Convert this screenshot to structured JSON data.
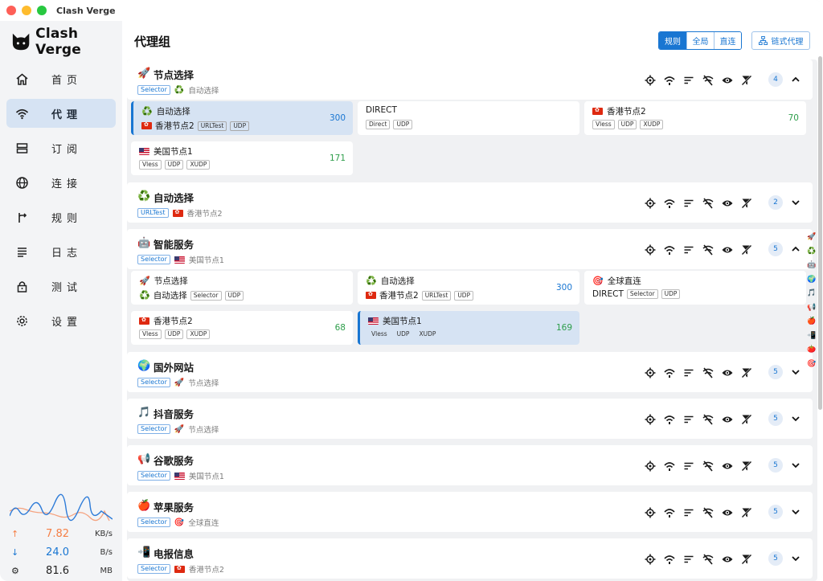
{
  "window": {
    "title": "Clash Verge"
  },
  "brand": {
    "name": "Clash Verge"
  },
  "nav": [
    {
      "label": "首页",
      "icon": "home-icon"
    },
    {
      "label": "代理",
      "icon": "wifi-icon",
      "active": true
    },
    {
      "label": "订阅",
      "icon": "storage-icon"
    },
    {
      "label": "连接",
      "icon": "globe-icon"
    },
    {
      "label": "规则",
      "icon": "fork-icon"
    },
    {
      "label": "日志",
      "icon": "lines-icon"
    },
    {
      "label": "测试",
      "icon": "lock-icon"
    },
    {
      "label": "设置",
      "icon": "gear-icon"
    }
  ],
  "stats": {
    "upload": {
      "value": "7.82",
      "unit": "KB/s",
      "color": "#f57f45"
    },
    "download": {
      "value": "24.0",
      "unit": "B/s",
      "color": "#1976d2"
    },
    "memory": {
      "value": "81.6",
      "unit": "MB"
    }
  },
  "header": {
    "title": "代理组",
    "modes": [
      "规则",
      "全局",
      "直连"
    ],
    "active_mode": "规则",
    "chain_label": "链式代理"
  },
  "colors": {
    "accent": "#1976d2",
    "delay_green": "#2e9e4b",
    "selected_bg": "#d6e3f3"
  },
  "groups": [
    {
      "icon": "🚀",
      "name": "节点选择",
      "type": "Selector",
      "now_icon": "♻️",
      "now": "自动选择",
      "count": "4",
      "expanded": true,
      "proxies": [
        {
          "icon": "♻️",
          "name": "自动选择",
          "sub_flag": "hk",
          "sub": "香港节点2",
          "tags": [
            "URLTest",
            "UDP"
          ],
          "delay": "300",
          "delay_color": "blue",
          "selected": true
        },
        {
          "name": "DIRECT",
          "tags": [
            "Direct",
            "UDP"
          ]
        },
        {
          "flag": "hk",
          "name": "香港节点2",
          "tags": [
            "Vless",
            "UDP",
            "XUDP"
          ],
          "delay": "70",
          "delay_color": "green"
        },
        {
          "flag": "us",
          "name": "美国节点1",
          "tags": [
            "Vless",
            "UDP",
            "XUDP"
          ],
          "delay": "171",
          "delay_color": "green"
        }
      ]
    },
    {
      "icon": "♻️",
      "name": "自动选择",
      "type": "URLTest",
      "now_flag": "hk",
      "now": "香港节点2",
      "count": "2",
      "expanded": false
    },
    {
      "icon": "🤖",
      "name": "智能服务",
      "type": "Selector",
      "now_flag": "us",
      "now": "美国节点1",
      "count": "5",
      "expanded": true,
      "proxies": [
        {
          "icon": "🚀",
          "name": "节点选择",
          "sub_icon": "♻️",
          "sub": "自动选择",
          "tags": [
            "Selector",
            "UDP"
          ]
        },
        {
          "icon": "♻️",
          "name": "自动选择",
          "sub_flag": "hk",
          "sub": "香港节点2",
          "tags": [
            "URLTest",
            "UDP"
          ],
          "delay": "300",
          "delay_color": "blue"
        },
        {
          "icon": "🎯",
          "name": "全球直连",
          "sub": "DIRECT",
          "tags": [
            "Selector",
            "UDP"
          ]
        },
        {
          "flag": "hk",
          "name": "香港节点2",
          "tags": [
            "Vless",
            "UDP",
            "XUDP"
          ],
          "delay": "68",
          "delay_color": "green"
        },
        {
          "flag": "us",
          "name": "美国节点1",
          "tags": [
            "Vless",
            "UDP",
            "XUDP"
          ],
          "delay": "169",
          "delay_color": "green",
          "selected": true
        }
      ]
    },
    {
      "icon": "🌍",
      "name": "国外网站",
      "type": "Selector",
      "now_icon": "🚀",
      "now": "节点选择",
      "count": "5",
      "expanded": false
    },
    {
      "icon": "🎵",
      "name": "抖音服务",
      "type": "Selector",
      "now_icon": "🚀",
      "now": "节点选择",
      "count": "5",
      "expanded": false
    },
    {
      "icon": "📢",
      "name": "谷歌服务",
      "type": "Selector",
      "now_flag": "us",
      "now": "美国节点1",
      "count": "5",
      "expanded": false
    },
    {
      "icon": "🍎",
      "name": "苹果服务",
      "type": "Selector",
      "now_icon": "🎯",
      "now": "全球直连",
      "count": "5",
      "expanded": false
    },
    {
      "icon": "📲",
      "name": "电报信息",
      "type": "Selector",
      "now_flag": "hk",
      "now": "香港节点2",
      "count": "5",
      "expanded": false
    }
  ],
  "index_bar": [
    "🚀",
    "♻️",
    "🤖",
    "🌍",
    "🎵",
    "📢",
    "🍎",
    "📲",
    "🍅",
    "🎯"
  ]
}
